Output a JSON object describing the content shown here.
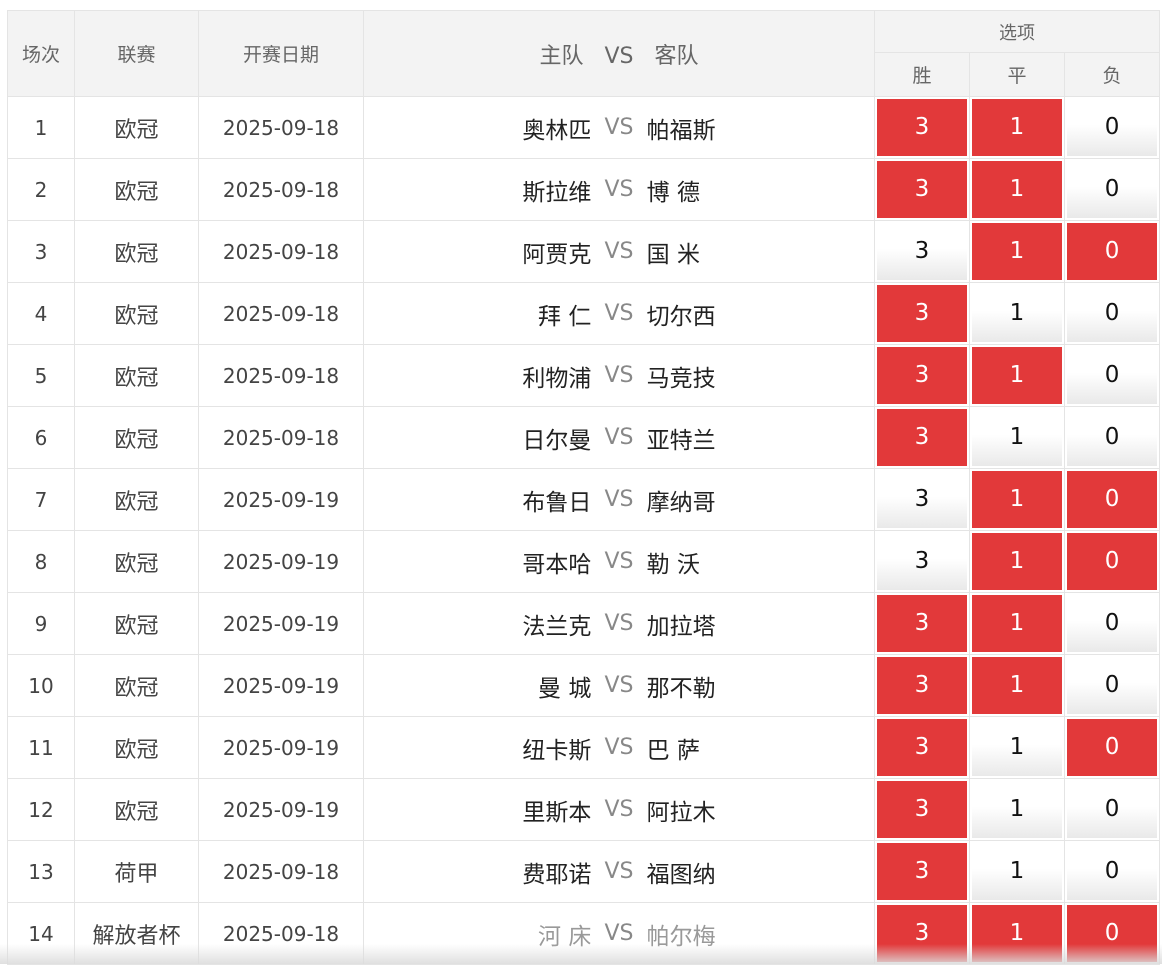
{
  "headers": {
    "index": "场次",
    "league": "联赛",
    "date": "开赛日期",
    "match": {
      "home": "主队",
      "vs": "VS",
      "away": "客队"
    },
    "options": "选项",
    "win": "胜",
    "draw": "平",
    "lose": "负"
  },
  "vs_text": "VS",
  "rows": [
    {
      "index": "1",
      "league": "欧冠",
      "date": "2025-09-18",
      "home": "奥林匹",
      "away": "帕福斯",
      "dim": false,
      "win": "3",
      "draw": "1",
      "lose": "0",
      "win_selected": true,
      "draw_selected": true,
      "lose_selected": false
    },
    {
      "index": "2",
      "league": "欧冠",
      "date": "2025-09-18",
      "home": "斯拉维",
      "away": "博 德",
      "dim": false,
      "win": "3",
      "draw": "1",
      "lose": "0",
      "win_selected": true,
      "draw_selected": true,
      "lose_selected": false
    },
    {
      "index": "3",
      "league": "欧冠",
      "date": "2025-09-18",
      "home": "阿贾克",
      "away": "国 米",
      "dim": false,
      "win": "3",
      "draw": "1",
      "lose": "0",
      "win_selected": false,
      "draw_selected": true,
      "lose_selected": true
    },
    {
      "index": "4",
      "league": "欧冠",
      "date": "2025-09-18",
      "home": "拜 仁",
      "away": "切尔西",
      "dim": false,
      "win": "3",
      "draw": "1",
      "lose": "0",
      "win_selected": true,
      "draw_selected": false,
      "lose_selected": false
    },
    {
      "index": "5",
      "league": "欧冠",
      "date": "2025-09-18",
      "home": "利物浦",
      "away": "马竞技",
      "dim": false,
      "win": "3",
      "draw": "1",
      "lose": "0",
      "win_selected": true,
      "draw_selected": true,
      "lose_selected": false
    },
    {
      "index": "6",
      "league": "欧冠",
      "date": "2025-09-18",
      "home": "日尔曼",
      "away": "亚特兰",
      "dim": false,
      "win": "3",
      "draw": "1",
      "lose": "0",
      "win_selected": true,
      "draw_selected": false,
      "lose_selected": false
    },
    {
      "index": "7",
      "league": "欧冠",
      "date": "2025-09-19",
      "home": "布鲁日",
      "away": "摩纳哥",
      "dim": false,
      "win": "3",
      "draw": "1",
      "lose": "0",
      "win_selected": false,
      "draw_selected": true,
      "lose_selected": true
    },
    {
      "index": "8",
      "league": "欧冠",
      "date": "2025-09-19",
      "home": "哥本哈",
      "away": "勒 沃",
      "dim": false,
      "win": "3",
      "draw": "1",
      "lose": "0",
      "win_selected": false,
      "draw_selected": true,
      "lose_selected": true
    },
    {
      "index": "9",
      "league": "欧冠",
      "date": "2025-09-19",
      "home": "法兰克",
      "away": "加拉塔",
      "dim": false,
      "win": "3",
      "draw": "1",
      "lose": "0",
      "win_selected": true,
      "draw_selected": true,
      "lose_selected": false
    },
    {
      "index": "10",
      "league": "欧冠",
      "date": "2025-09-19",
      "home": "曼 城",
      "away": "那不勒",
      "dim": false,
      "win": "3",
      "draw": "1",
      "lose": "0",
      "win_selected": true,
      "draw_selected": true,
      "lose_selected": false
    },
    {
      "index": "11",
      "league": "欧冠",
      "date": "2025-09-19",
      "home": "纽卡斯",
      "away": "巴 萨",
      "dim": false,
      "win": "3",
      "draw": "1",
      "lose": "0",
      "win_selected": true,
      "draw_selected": false,
      "lose_selected": true
    },
    {
      "index": "12",
      "league": "欧冠",
      "date": "2025-09-19",
      "home": "里斯本",
      "away": "阿拉木",
      "dim": false,
      "win": "3",
      "draw": "1",
      "lose": "0",
      "win_selected": true,
      "draw_selected": false,
      "lose_selected": false
    },
    {
      "index": "13",
      "league": "荷甲",
      "date": "2025-09-18",
      "home": "费耶诺",
      "away": "福图纳",
      "dim": false,
      "win": "3",
      "draw": "1",
      "lose": "0",
      "win_selected": true,
      "draw_selected": false,
      "lose_selected": false
    },
    {
      "index": "14",
      "league": "解放者杯",
      "date": "2025-09-18",
      "home": "河 床",
      "away": "帕尔梅",
      "dim": true,
      "win": "3",
      "draw": "1",
      "lose": "0",
      "win_selected": true,
      "draw_selected": true,
      "lose_selected": true
    }
  ],
  "colors": {
    "selected": "#e2393a",
    "header_bg": "#f3f3f3",
    "border": "#e4e4e4"
  }
}
